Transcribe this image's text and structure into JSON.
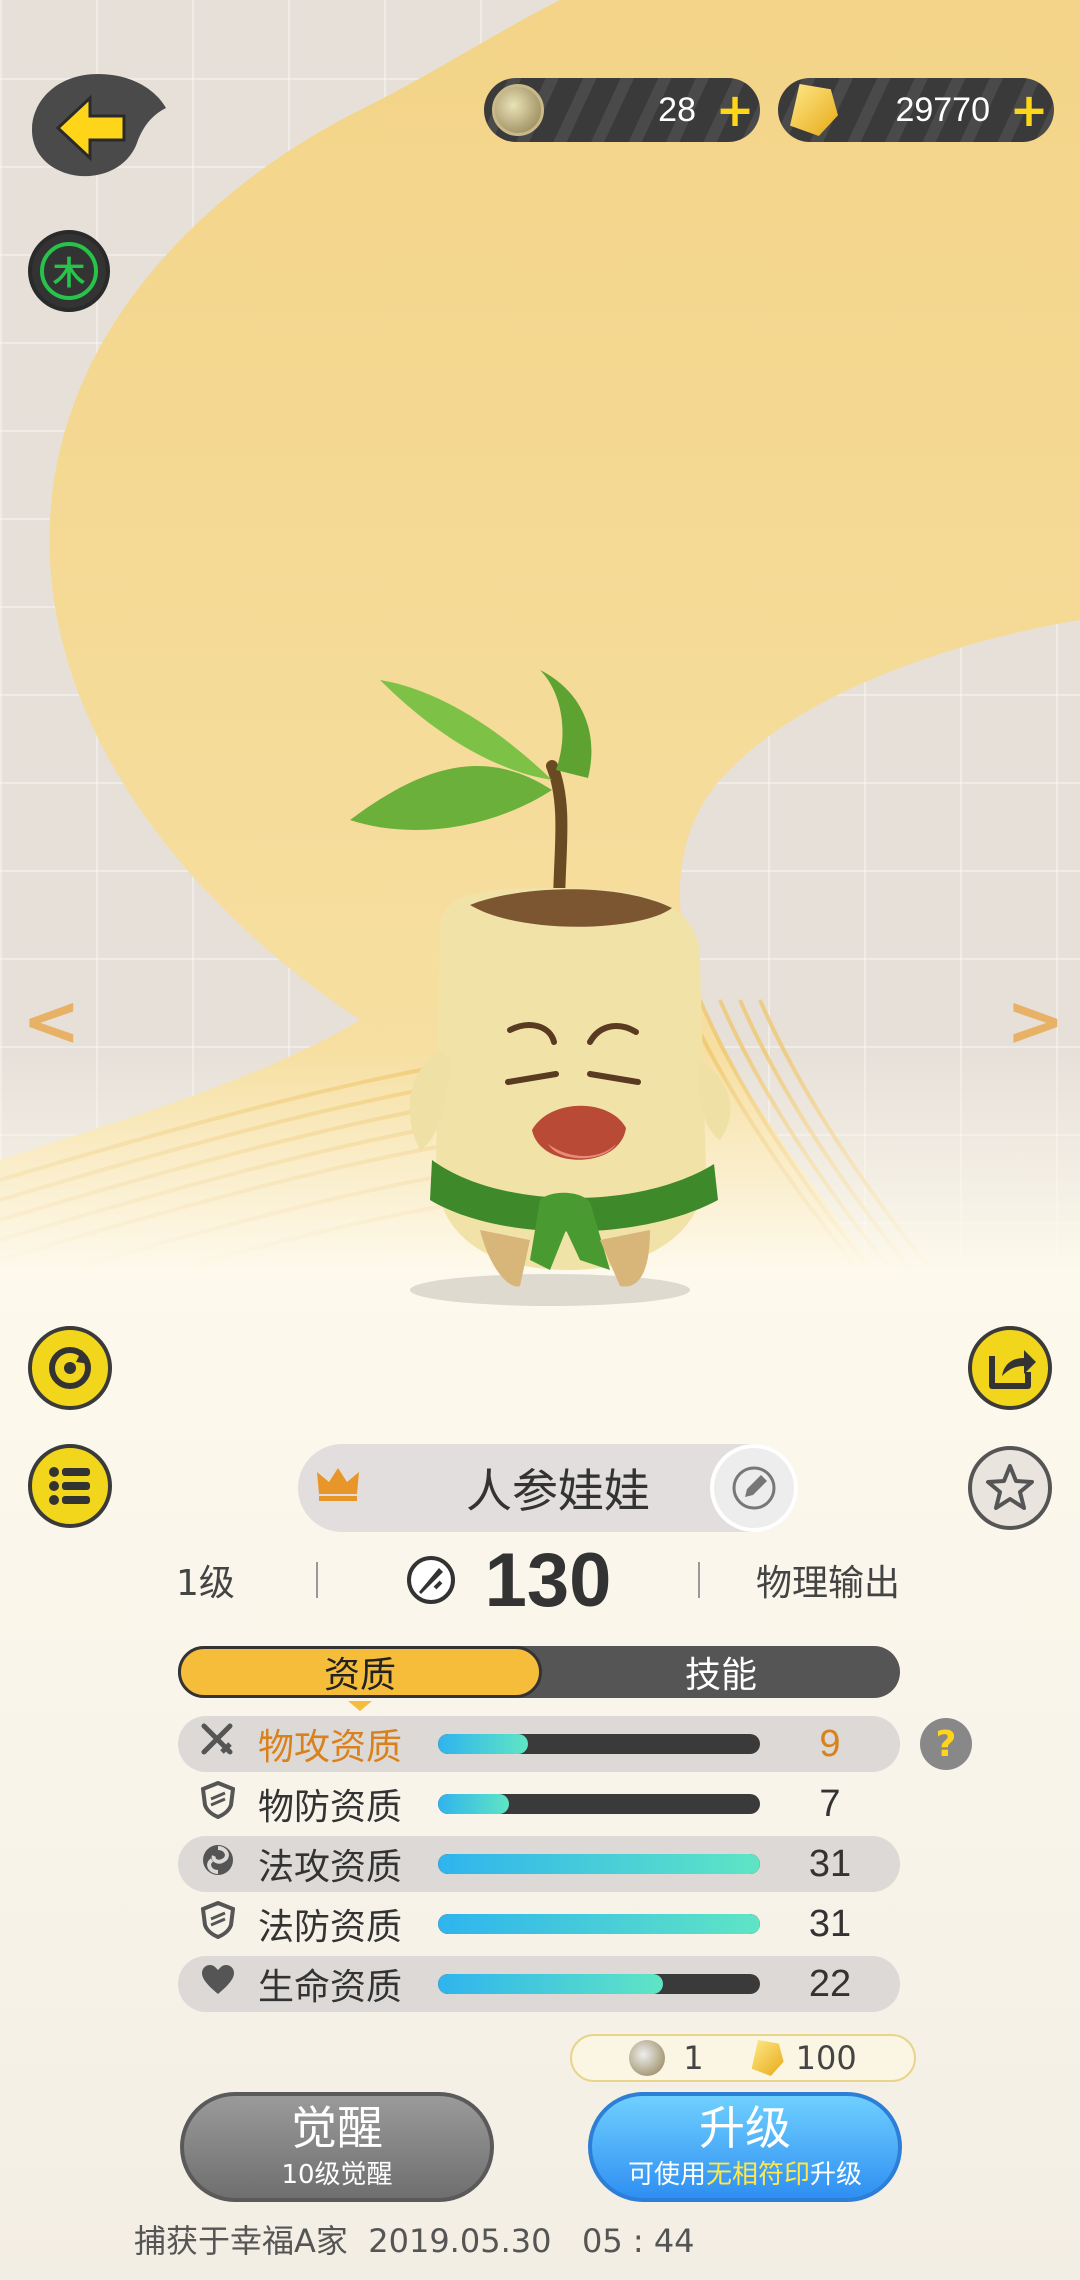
{
  "currency": {
    "coin_count": "28",
    "gem_count": "29770",
    "plus_label": "+"
  },
  "header": {
    "element_badge": "木"
  },
  "navigation": {
    "prev_arrow": "<",
    "next_arrow": ">"
  },
  "creature": {
    "name": "人参娃娃",
    "level": "1级",
    "power": "130",
    "role": "物理输出"
  },
  "tabs": [
    {
      "label": "资质",
      "active": true
    },
    {
      "label": "技能",
      "active": false
    }
  ],
  "stats": [
    {
      "label": "物攻资质",
      "value": "9",
      "fraction": 0.28,
      "icon": "sword-icon",
      "highlight": true
    },
    {
      "label": "物防资质",
      "value": "7",
      "fraction": 0.22,
      "icon": "shield-icon",
      "highlight": false
    },
    {
      "label": "法攻资质",
      "value": "31",
      "fraction": 1.0,
      "icon": "spiral-icon",
      "highlight": false
    },
    {
      "label": "法防资质",
      "value": "31",
      "fraction": 1.0,
      "icon": "shield-icon",
      "highlight": false
    },
    {
      "label": "生命资质",
      "value": "22",
      "fraction": 0.7,
      "icon": "heart-icon",
      "highlight": false
    }
  ],
  "help_label": "?",
  "cost": {
    "coin_cost": "1",
    "gem_cost": "100"
  },
  "buttons": {
    "awaken_title": "觉醒",
    "awaken_sub": "10级觉醒",
    "upgrade_title": "升级",
    "upgrade_sub_prefix": "可使用",
    "upgrade_sub_highlight": "无相符印",
    "upgrade_sub_suffix": "升级"
  },
  "capture_info": "捕获于幸福A家  2019.05.30   05 : 44",
  "colors": {
    "accent_yellow": "#f5bd3a",
    "highlight_orange": "#d9821d",
    "bar_fill": "#2fb4ee",
    "element_green": "#27c34b"
  }
}
